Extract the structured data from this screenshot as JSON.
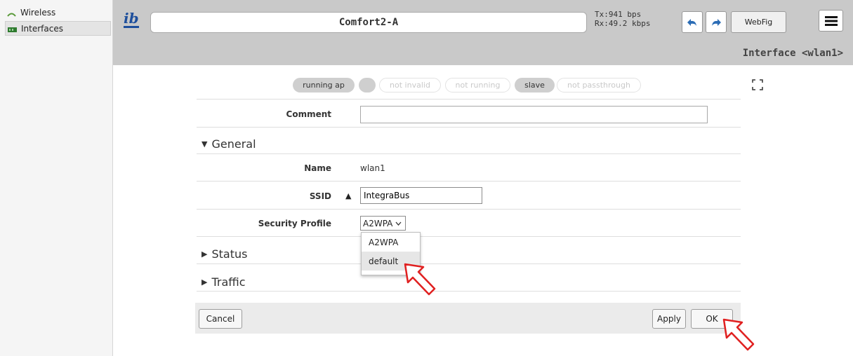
{
  "sidebar": {
    "items": [
      {
        "label": "Wireless",
        "icon": "wireless-icon"
      },
      {
        "label": "Interfaces",
        "icon": "interfaces-icon",
        "active": true
      }
    ]
  },
  "header": {
    "identity": "Comfort2-A",
    "tx": "Tx:941 bps",
    "rx": "Rx:49.2 kbps",
    "webfig_label": "WebFig",
    "breadcrumb": "Interface <wlan1>"
  },
  "status_flags": [
    {
      "label": "running ap",
      "active": true
    },
    {
      "label": "",
      "active": true
    },
    {
      "label": "not invalid",
      "active": false
    },
    {
      "label": "not running",
      "active": false
    },
    {
      "label": "slave",
      "active": true
    },
    {
      "label": "not passthrough",
      "active": false
    }
  ],
  "form": {
    "comment_label": "Comment",
    "comment_value": "",
    "general_title": "General",
    "name_label": "Name",
    "name_value": "wlan1",
    "ssid_label": "SSID",
    "ssid_value": "IntegraBus",
    "security_label": "Security Profile",
    "security_value": "A2WPA",
    "security_options": [
      "A2WPA",
      "default"
    ],
    "status_title": "Status",
    "traffic_title": "Traffic"
  },
  "buttons": {
    "cancel": "Cancel",
    "apply": "Apply",
    "ok": "OK"
  },
  "colors": {
    "topbar": "#c9c9c9",
    "arrow": "#e02020"
  }
}
